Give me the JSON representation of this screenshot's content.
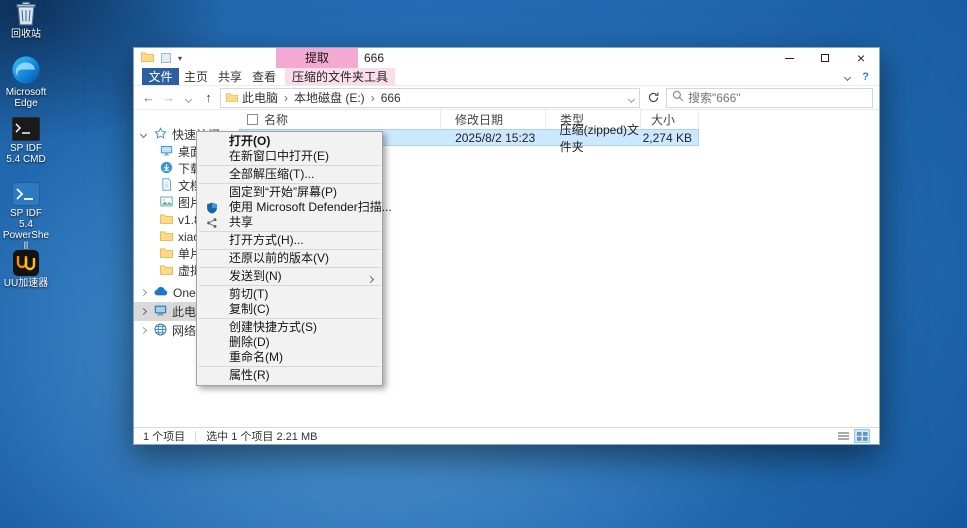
{
  "desktop": {
    "icons": [
      {
        "label": "回收站"
      },
      {
        "label": "Microsoft Edge"
      },
      {
        "label": "SP IDF 5.4 CMD"
      },
      {
        "label": "SP IDF 5.4 PowerShell"
      },
      {
        "label": "UU加速器"
      }
    ]
  },
  "window": {
    "title": "666",
    "contextual_tab": "提取",
    "ribbon": {
      "file_tab": "文件",
      "tabs": [
        "主页",
        "共享",
        "查看"
      ],
      "tool_tab": "压缩的文件夹工具",
      "help_glyph": "?"
    },
    "address": {
      "breadcrumb": [
        "此电脑",
        "本地磁盘 (E:)",
        "666"
      ],
      "search_placeholder": "搜索\"666\""
    },
    "sidebar": {
      "items": [
        {
          "label": "快速访问"
        },
        {
          "label": "桌面"
        },
        {
          "label": "下载"
        },
        {
          "label": "文档"
        },
        {
          "label": "图片"
        },
        {
          "label": "v1.8.2_E"
        },
        {
          "label": "xiaozhi_"
        },
        {
          "label": "单片机"
        },
        {
          "label": "虚拟共享"
        },
        {
          "label": "OneDrive"
        },
        {
          "label": "此电脑"
        },
        {
          "label": "网络"
        }
      ]
    },
    "file_list": {
      "columns": [
        "名称",
        "修改日期",
        "类型",
        "大小"
      ],
      "rows": [
        {
          "name": "",
          "date": "2025/8/2 15:23",
          "type": "压缩(zipped)文件夹",
          "size": "2,274 KB"
        }
      ]
    },
    "status": {
      "count": "1 个项目",
      "selection": "选中 1 个项目 2.21 MB"
    }
  },
  "context_menu": {
    "items": [
      {
        "label": "打开(O)"
      },
      {
        "label": "在新窗口中打开(E)"
      },
      {
        "sep": true
      },
      {
        "label": "全部解压缩(T)..."
      },
      {
        "sep": true
      },
      {
        "label": "固定到“开始”屏幕(P)"
      },
      {
        "label": "使用 Microsoft Defender扫描..."
      },
      {
        "label": "共享"
      },
      {
        "sep": true
      },
      {
        "label": "打开方式(H)..."
      },
      {
        "sep": true
      },
      {
        "label": "还原以前的版本(V)"
      },
      {
        "sep": true
      },
      {
        "label": "发送到(N)"
      },
      {
        "sep": true
      },
      {
        "label": "剪切(T)"
      },
      {
        "label": "复制(C)"
      },
      {
        "sep": true
      },
      {
        "label": "创建快捷方式(S)"
      },
      {
        "label": "删除(D)"
      },
      {
        "label": "重命名(M)"
      },
      {
        "sep": true
      },
      {
        "label": "属性(R)"
      }
    ]
  }
}
